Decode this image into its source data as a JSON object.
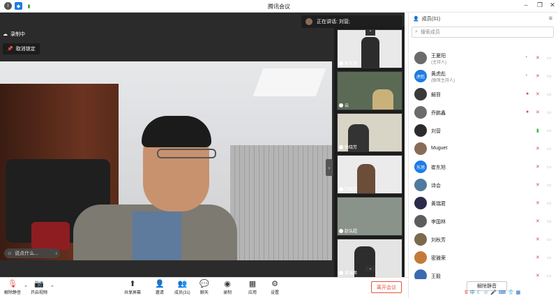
{
  "window": {
    "title": "腾讯会议",
    "controls": [
      "–",
      "❐",
      "✕"
    ]
  },
  "status": {
    "recording_label": "录制中",
    "unlock_label": "取消锁定",
    "speaking_label": "正在讲话: 刘营;",
    "chat_placeholder": "说点什么..."
  },
  "thumbnails": [
    {
      "name": "崔东旭"
    },
    {
      "name": "云"
    },
    {
      "name": "徐晓芳"
    },
    {
      "name": "刘秋芳"
    },
    {
      "name": "赵弘超"
    },
    {
      "name": "黄瑞君"
    }
  ],
  "toolbar": {
    "unmute_label": "解除静音",
    "video_label": "开启视频",
    "share_label": "共享屏幕",
    "invite_label": "邀请",
    "members_label": "成员(31)",
    "chat_label": "聊天",
    "record_label": "录制",
    "apps_label": "应用",
    "settings_label": "设置",
    "leave_label": "离开会议"
  },
  "panel": {
    "title": "成员(31)",
    "search_placeholder": "搜索成员",
    "unmute_all_label": "解除静音",
    "members": [
      {
        "name": "王夏阳",
        "role": "(主持人)",
        "avatar_text": "",
        "avatar_color": "#6b6b6b",
        "status": "muted-rec"
      },
      {
        "name": "黄虎彪",
        "role": "(联席主持人)",
        "avatar_text": "虎彪",
        "avatar_color": "#1e7be5",
        "status": "muted-rec"
      },
      {
        "name": "解菲",
        "role": "",
        "avatar_text": "",
        "avatar_color": "#3a3a3a",
        "status": "rec-muted"
      },
      {
        "name": "乔鹏鑫",
        "role": "",
        "avatar_text": "",
        "avatar_color": "#6b6b6b",
        "status": "rec-muted"
      },
      {
        "name": "刘营",
        "role": "",
        "avatar_text": "",
        "avatar_color": "#2c2c2c",
        "status": "speaking"
      },
      {
        "name": "Muguet",
        "role": "",
        "avatar_text": "",
        "avatar_color": "#8a6b58",
        "status": "muted"
      },
      {
        "name": "崔东旭",
        "role": "",
        "avatar_text": "东旭",
        "avatar_color": "#1e7be5",
        "status": "muted"
      },
      {
        "name": "诗会",
        "role": "",
        "avatar_text": "",
        "avatar_color": "#4f7aa0",
        "status": "muted"
      },
      {
        "name": "黄瑞君",
        "role": "",
        "avatar_text": "",
        "avatar_color": "#2a2a4a",
        "status": "muted"
      },
      {
        "name": "李国林",
        "role": "",
        "avatar_text": "",
        "avatar_color": "#5d5d5d",
        "status": "muted"
      },
      {
        "name": "刘秋芳",
        "role": "",
        "avatar_text": "",
        "avatar_color": "#7b6a4c",
        "status": "muted"
      },
      {
        "name": "密雅荣",
        "role": "",
        "avatar_text": "",
        "avatar_color": "#c27b3a",
        "status": "muted"
      },
      {
        "name": "王毅",
        "role": "",
        "avatar_text": "",
        "avatar_color": "#3a6bb0",
        "status": "muted"
      }
    ]
  },
  "ime": {
    "label": "中"
  },
  "colors": {
    "accent_blue": "#1e7be5",
    "leave_red": "#e5523f",
    "muted_red": "#e24a4a",
    "speaking_green": "#3fbf3f"
  }
}
